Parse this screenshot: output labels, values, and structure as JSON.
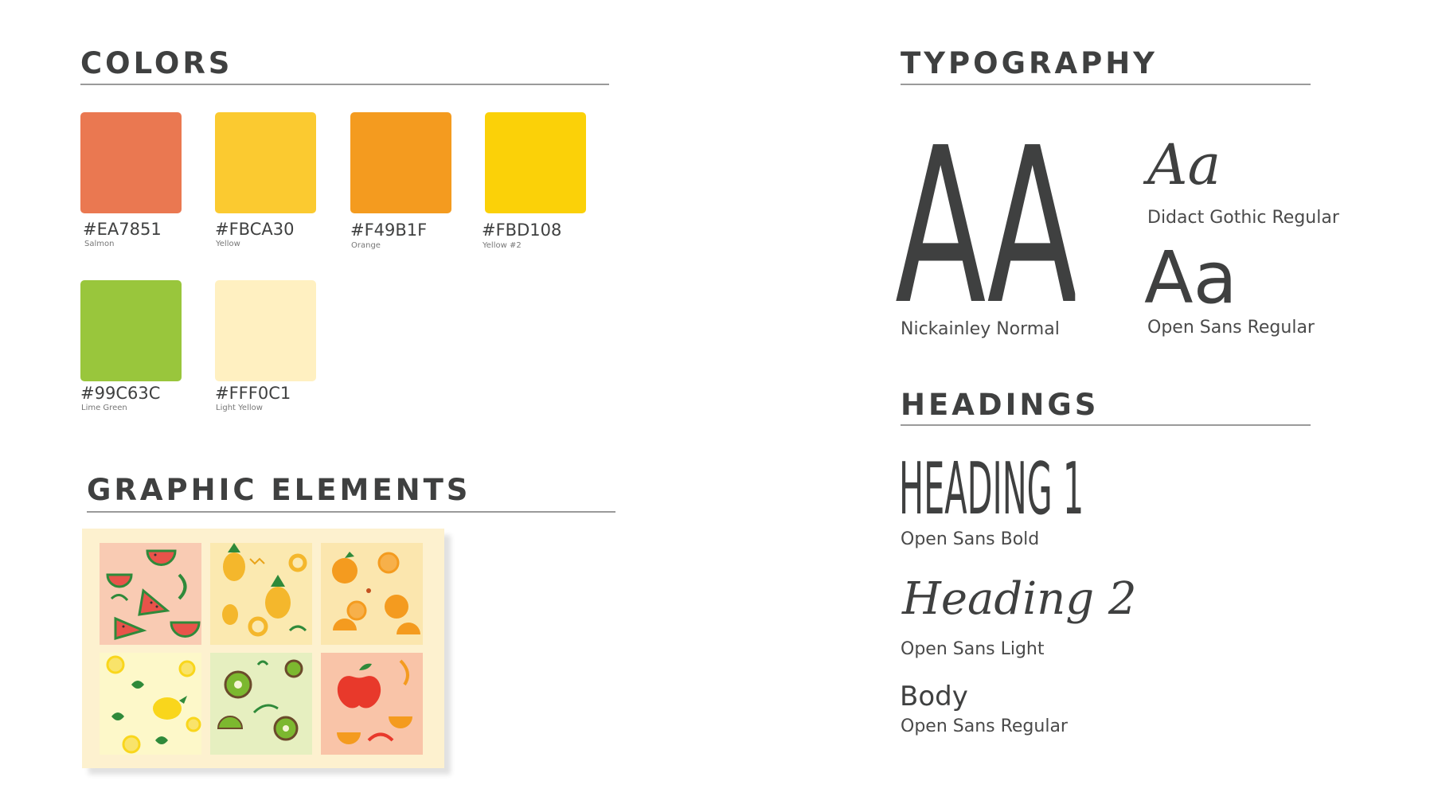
{
  "sections": {
    "colors_title": "COLORS",
    "graphic_title": "GRAPHIC ELEMENTS",
    "typography_title": "TYPOGRAPHY",
    "headings_title": "HEADINGS"
  },
  "colors": [
    {
      "hex": "#EA7851",
      "name": "Salmon"
    },
    {
      "hex": "#FBCA30",
      "name": "Yellow"
    },
    {
      "hex": "#F49B1F",
      "name": "Orange"
    },
    {
      "hex": "#FBD108",
      "name": "Yellow #2"
    },
    {
      "hex": "#99C63C",
      "name": "Lime Green"
    },
    {
      "hex": "#FFF0C1",
      "name": "Light Yellow"
    }
  ],
  "typography": {
    "sample_aa_display": "AA",
    "display_font": "Nickainley Normal",
    "sample_aa_script": "Aa",
    "script_font": "Didact Gothic Regular",
    "sample_aa_sans": "Aa",
    "sans_font": "Open Sans Regular"
  },
  "headings": {
    "h1_sample": "HEADING 1",
    "h1_font": "Open Sans Bold",
    "h2_sample": "Heading 2",
    "h2_font": "Open Sans Light",
    "body_sample": "Body",
    "body_font": "Open Sans Regular"
  },
  "graphic_elements": {
    "patterns": [
      {
        "fruit": "watermelon",
        "background": "#f9cbb3"
      },
      {
        "fruit": "pineapple",
        "background": "#fbe9b0"
      },
      {
        "fruit": "orange",
        "background": "#fbe6ae"
      },
      {
        "fruit": "lemon",
        "background": "#fdf8c9"
      },
      {
        "fruit": "kiwi",
        "background": "#e6efc0"
      },
      {
        "fruit": "apple",
        "background": "#f9c4a8"
      }
    ]
  }
}
